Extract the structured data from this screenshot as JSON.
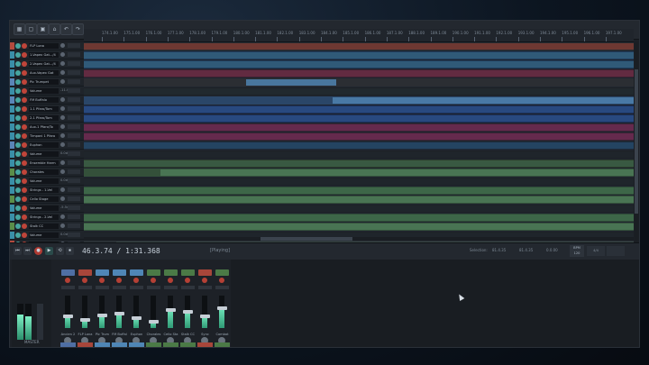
{
  "toolbar": {
    "buttons": [
      "▦",
      "▢",
      "▣",
      "⌂",
      "↶",
      "↷",
      "⚙",
      "◧",
      "▲"
    ]
  },
  "ruler": {
    "ticks": [
      "174.1.00",
      "175.1.00",
      "176.1.00",
      "177.1.00",
      "178.1.00",
      "179.1.00",
      "180.1.00",
      "181.1.00",
      "182.1.00",
      "183.1.00",
      "184.1.00",
      "185.1.00",
      "186.1.00",
      "187.1.00",
      "188.1.00",
      "189.1.00",
      "190.1.00",
      "191.1.00",
      "192.1.00",
      "193.1.00",
      "194.1.00",
      "195.1.00",
      "196.1.00",
      "197.1.00"
    ]
  },
  "tracks": [
    {
      "name": "FLP Lona",
      "color": "#b34a3e",
      "value": ""
    },
    {
      "name": "1-Vapex Gat.../4",
      "color": "#3a8fa8",
      "value": ""
    },
    {
      "name": "2-Vapex Gat.../4",
      "color": "#3a8fa8",
      "value": ""
    },
    {
      "name": "Aux-Vapex Gat",
      "color": "#3a8fa8",
      "value": ""
    },
    {
      "name": "Pic Trumpet",
      "color": "#5a86b8",
      "value": ""
    },
    {
      "name": "Volume",
      "color": "#3a8fa8",
      "value": "-11.0dB"
    },
    {
      "name": "FM Buffalo",
      "color": "#5a86b8",
      "value": ""
    },
    {
      "name": "1-1 Pfaro/Tom",
      "color": "#3a8fa8",
      "value": ""
    },
    {
      "name": "2-1 Pfaro/Tom",
      "color": "#3a8fa8",
      "value": ""
    },
    {
      "name": "Aux-1 Pfaro/To",
      "color": "#3a8fa8",
      "value": ""
    },
    {
      "name": "Timpani 1 Pfaro",
      "color": "#3a8fa8",
      "value": ""
    },
    {
      "name": "Euphon",
      "color": "#5a86b8",
      "value": ""
    },
    {
      "name": "Volume",
      "color": "#3a8fa8",
      "value": "0.0dB"
    },
    {
      "name": "Ensemble Harm",
      "color": "#3a8fa8",
      "value": ""
    },
    {
      "name": "Chorales",
      "color": "#5a8e4a",
      "value": ""
    },
    {
      "name": "Volume",
      "color": "#3a8fa8",
      "value": "0.0dB"
    },
    {
      "name": "Strings - 1-Vel",
      "color": "#3a8fa8",
      "value": ""
    },
    {
      "name": "Cello Stage",
      "color": "#5a8e4a",
      "value": ""
    },
    {
      "name": "Volume",
      "color": "#3a8fa8",
      "value": "-5.5dB"
    },
    {
      "name": "Strings - 2-Vel",
      "color": "#3a8fa8",
      "value": ""
    },
    {
      "name": "Stalk CC",
      "color": "#5a8e4a",
      "value": ""
    },
    {
      "name": "Volume",
      "color": "#3a8fa8",
      "value": "0.0dB"
    },
    {
      "name": "Sync",
      "color": "#b34a3e",
      "value": ""
    }
  ],
  "transport": {
    "time": "46.3.74 / 1:31.368",
    "status": "[Playing]",
    "selection_label": "Selection:",
    "sel_start": "81.4.35",
    "sel_end": "81.4.35",
    "sel_len": "0.0.00",
    "bpm_label": "BPM",
    "bpm_value": "120",
    "sig": "4/4",
    "buttons": [
      "⏮",
      "⏭",
      "●",
      "▶",
      "⟲",
      "⏸",
      "⏹"
    ]
  },
  "mixer": {
    "master_label": "MASTER",
    "strips": [
      {
        "name": "Ancien 2",
        "color": "#4f6fa4",
        "level": 0.35
      },
      {
        "name": "FLP Lona",
        "color": "#a8463a",
        "level": 0.25
      },
      {
        "name": "Pic Trum",
        "color": "#4f86b6",
        "level": 0.4
      },
      {
        "name": "FM Buffal",
        "color": "#4f86b6",
        "level": 0.45
      },
      {
        "name": "Euphon",
        "color": "#4f86b6",
        "level": 0.3
      },
      {
        "name": "Chorales",
        "color": "#4b7a46",
        "level": 0.2
      },
      {
        "name": "Cello Sta",
        "color": "#4b7a46",
        "level": 0.55
      },
      {
        "name": "Stalk CC",
        "color": "#4b7a46",
        "level": 0.5
      },
      {
        "name": "Sync",
        "color": "#a8463a",
        "level": 0.35
      },
      {
        "name": "Combat",
        "color": "#4b7a46",
        "level": 0.6
      }
    ]
  }
}
